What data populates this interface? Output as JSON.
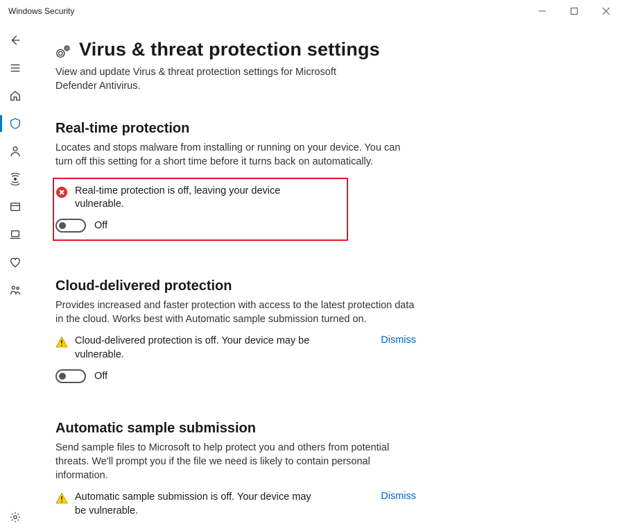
{
  "window": {
    "title": "Windows Security"
  },
  "page": {
    "title": "Virus & threat protection settings",
    "subtitle": "View and update Virus & threat protection settings for Microsoft Defender Antivirus."
  },
  "sections": {
    "realtime": {
      "title": "Real-time protection",
      "desc": "Locates and stops malware from installing or running on your device. You can turn off this setting for a short time before it turns back on automatically.",
      "alert": "Real-time protection is off, leaving your device vulnerable.",
      "toggle_label": "Off"
    },
    "cloud": {
      "title": "Cloud-delivered protection",
      "desc": "Provides increased and faster protection with access to the latest protection data in the cloud. Works best with Automatic sample submission turned on.",
      "alert": "Cloud-delivered protection is off. Your device may be vulnerable.",
      "dismiss": "Dismiss",
      "toggle_label": "Off"
    },
    "sample": {
      "title": "Automatic sample submission",
      "desc": "Send sample files to Microsoft to help protect you and others from potential threats. We'll prompt you if the file we need is likely to contain personal information.",
      "alert": "Automatic sample submission is off. Your device may be vulnerable.",
      "dismiss": "Dismiss"
    }
  }
}
